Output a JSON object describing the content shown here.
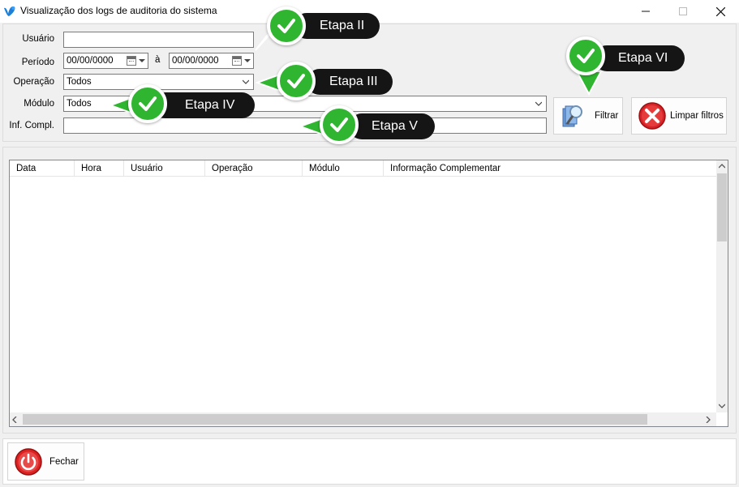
{
  "window": {
    "title": "Visualização dos logs de auditoria do sistema",
    "icon": "app-logo-icon",
    "controls": [
      "minimize-icon",
      "maximize-icon",
      "close-icon"
    ]
  },
  "filters": {
    "usuario_label": "Usuário",
    "usuario_value": "",
    "periodo_label": "Período",
    "periodo_from": "00/00/0000",
    "periodo_sep": "à",
    "periodo_to": "00/00/0000",
    "operacao_label": "Operação",
    "operacao_value": "Todos",
    "modulo_label": "Módulo",
    "modulo_value": "Todos",
    "infcompl_label": "Inf. Compl.",
    "infcompl_value": ""
  },
  "buttons": {
    "filtrar": "Filtrar",
    "limpar": "Limpar filtros",
    "fechar": "Fechar"
  },
  "grid": {
    "columns": [
      "Data",
      "Hora",
      "Usuário",
      "Operação",
      "Módulo",
      "Informação Complementar"
    ],
    "rows": []
  },
  "callouts": {
    "etapa2": "Etapa II",
    "etapa3": "Etapa III",
    "etapa4": "Etapa IV",
    "etapa5": "Etapa V",
    "etapa6": "Etapa VI"
  },
  "colors": {
    "callout_bg": "#151515",
    "check_green": "#2fb52f",
    "titlebar": "#ffffff",
    "window_bg": "#f0f0f0"
  }
}
